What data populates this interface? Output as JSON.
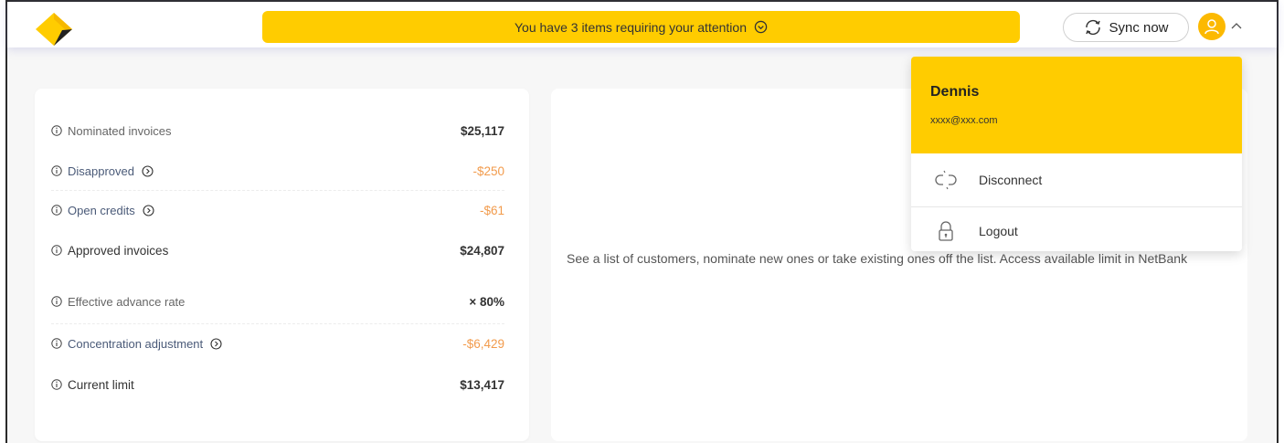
{
  "header": {
    "alert_text": "You have 3 items requiring your attention",
    "sync_label": "Sync now"
  },
  "summary": {
    "rows": [
      {
        "label": "Nominated invoices",
        "value": "$25,117"
      },
      {
        "label": "Disapproved",
        "value": "-$250"
      },
      {
        "label": "Open credits",
        "value": "-$61"
      },
      {
        "label": "Approved invoices",
        "value": "$24,807"
      },
      {
        "label": "Effective advance rate",
        "value": "× 80%"
      },
      {
        "label": "Concentration adjustment",
        "value": "-$6,429"
      },
      {
        "label": "Current limit",
        "value": "$13,417"
      }
    ]
  },
  "customers": {
    "description": "See a list of customers, nominate new ones or take existing ones off the list. Access available limit in NetBank"
  },
  "user_menu": {
    "name": "Dennis",
    "email": "xxxx@xxx.com",
    "items": [
      {
        "label": "Disconnect",
        "icon": "disconnect-icon"
      },
      {
        "label": "Logout",
        "icon": "lock-icon"
      }
    ]
  },
  "colors": {
    "brand_yellow": "#ffcc00",
    "negative": "#f29b4c",
    "link": "#4a5a78"
  }
}
